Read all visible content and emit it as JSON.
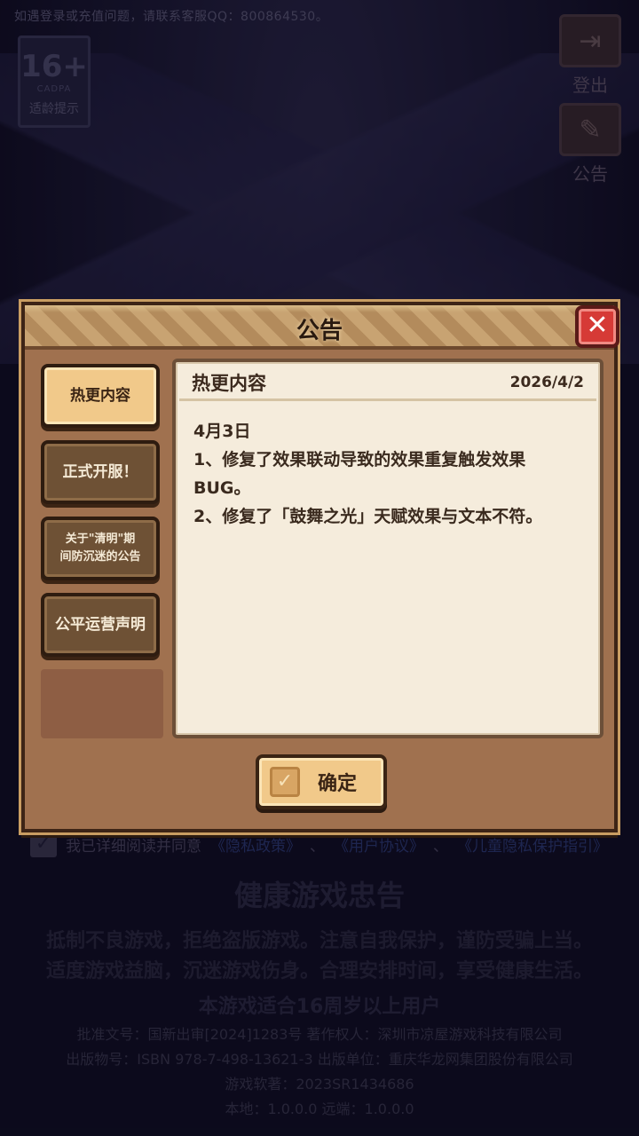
{
  "background": {
    "service_notice": "如遇登录或充值问题，请联系客服QQ：800864530。",
    "age_badge": {
      "number": "16+",
      "sub": "CADPA",
      "label": "适龄提示"
    },
    "logout_label": "登出",
    "notice_label": "公告",
    "agreement": {
      "prefix": "我已详细阅读并同意",
      "privacy": "《隐私政策》",
      "sep1": "、",
      "user": "《用户协议》",
      "sep2": "、",
      "child": "《儿童隐私保护指引》"
    },
    "health": {
      "title": "健康游戏忠告",
      "line1": "抵制不良游戏，拒绝盗版游戏。注意自我保护，谨防受骗上当。",
      "line2": "适度游戏益脑，沉迷游戏伤身。合理安排时间，享受健康生活。",
      "age_note": "本游戏适合16周岁以上用户"
    },
    "credits": {
      "line1": "批准文号：国新出审[2024]1283号  著作权人：深圳市凉屋游戏科技有限公司",
      "line2": "出版物号：ISBN 978-7-498-13621-3  出版单位：重庆华龙网集团股份有限公司",
      "line3": "游戏软著：2023SR1434686",
      "line4": "本地：1.0.0.0 远端：1.0.0.0"
    }
  },
  "modal": {
    "title": "公告",
    "close_symbol": "✕",
    "tabs": [
      {
        "label": "热更内容",
        "active": true
      },
      {
        "label": "正式开服！",
        "active": false
      },
      {
        "label_line1": "关于\"清明\"期",
        "label_line2": "间防沉迷的公告",
        "active": false
      },
      {
        "label": "公平运营声明",
        "active": false
      }
    ],
    "content": {
      "title": "热更内容",
      "date": "2026/4/2",
      "lines": [
        "4月3日",
        "1、修复了效果联动导致的效果重复触发效果",
        "BUG。",
        "2、修复了「鼓舞之光」天赋效果与文本不符。"
      ]
    },
    "confirm": {
      "label": "确定",
      "check_symbol": "✓"
    }
  },
  "colors": {
    "panel_brown": "#a0714f",
    "tab_active": "#f1c98a",
    "close_red": "#d63a36",
    "content_bg": "#f5ecdc"
  }
}
